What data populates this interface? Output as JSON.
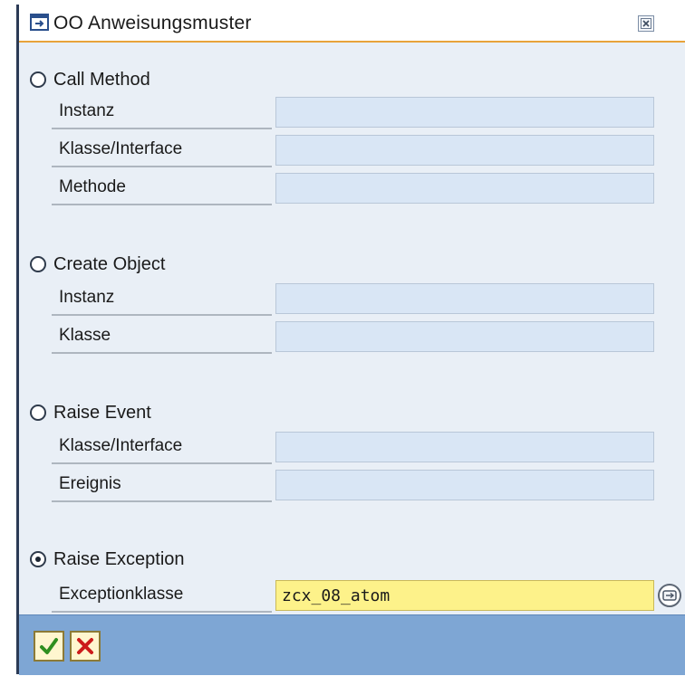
{
  "dialog": {
    "title": "OO Anweisungsmuster"
  },
  "sections": {
    "call_method": {
      "label": "Call Method",
      "selected": false,
      "fields": [
        {
          "label": "Instanz",
          "value": ""
        },
        {
          "label": "Klasse/Interface",
          "value": ""
        },
        {
          "label": "Methode",
          "value": ""
        }
      ]
    },
    "create_object": {
      "label": "Create Object",
      "selected": false,
      "fields": [
        {
          "label": "Instanz",
          "value": ""
        },
        {
          "label": "Klasse",
          "value": ""
        }
      ]
    },
    "raise_event": {
      "label": "Raise Event",
      "selected": false,
      "fields": [
        {
          "label": "Klasse/Interface",
          "value": ""
        },
        {
          "label": "Ereignis",
          "value": ""
        }
      ]
    },
    "raise_exception": {
      "label": "Raise Exception",
      "selected": true,
      "fields": [
        {
          "label": "Exceptionklasse",
          "value": "zcx_08_atom"
        }
      ]
    }
  },
  "icons": {
    "title": "dialog-window-icon",
    "close": "close-icon",
    "help": "value-help-icon",
    "confirm": "checkmark-icon",
    "cancel": "cancel-x-icon"
  },
  "colors": {
    "input_bg": "#d9e6f5",
    "active_input_bg": "#fdf28a",
    "footer_bg": "#7ea6d4",
    "title_accent": "#e8a33a",
    "confirm_green": "#2f8f1f",
    "cancel_red": "#cc1b1b"
  }
}
